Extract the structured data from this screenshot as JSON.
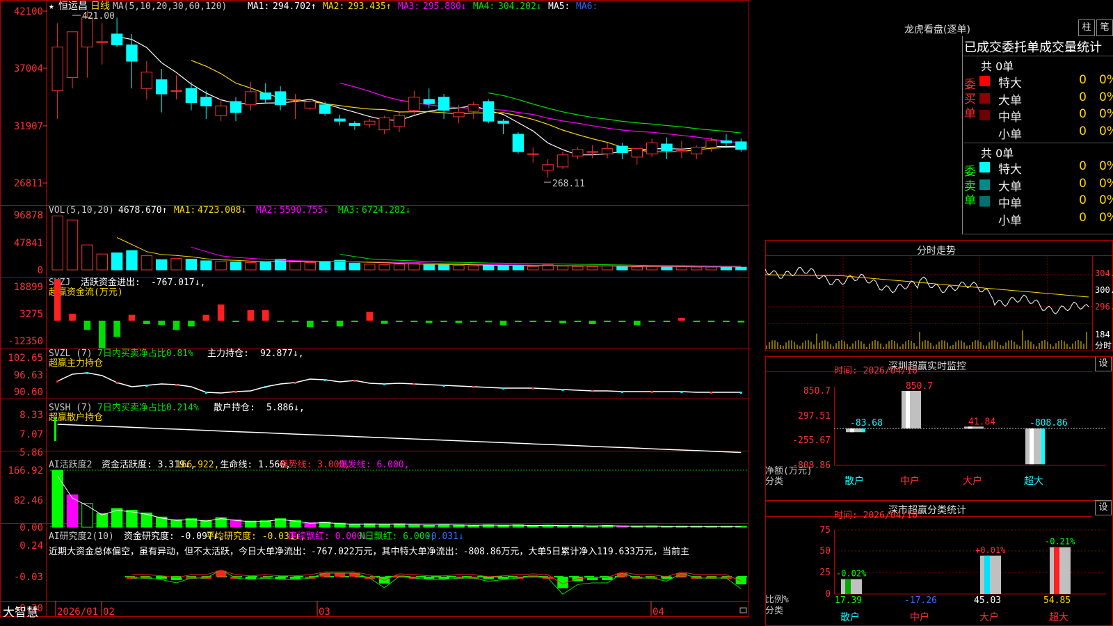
{
  "stock": {
    "star": "★",
    "name": "恒运昌",
    "period": "日线",
    "ma_title": "MA(5,10,20,30,60,120)",
    "ma": [
      {
        "k": "MA1:",
        "v": "294.702↑",
        "c": "#ffffff"
      },
      {
        "k": "MA2:",
        "v": "293.435↑",
        "c": "#ffd700"
      },
      {
        "k": "MA3:",
        "v": "295.880↓",
        "c": "#ff00ff"
      },
      {
        "k": "MA4:",
        "v": "304.202↓",
        "c": "#00e000"
      },
      {
        "k": "MA5:",
        "v": "",
        "c": "#ffffff"
      },
      {
        "k": "MA6:",
        "v": "",
        "c": "#3060ff"
      }
    ],
    "high_label": "421.00",
    "low_label": "268.11"
  },
  "axes": {
    "price": [
      "42100",
      "37004",
      "31907",
      "26811"
    ],
    "vol": [
      "96878",
      "47841",
      "0"
    ],
    "svzj": [
      "18899",
      "3275",
      "-12350"
    ],
    "svzl": [
      "102.65",
      "96.63",
      "90.60"
    ],
    "svsh": [
      "8.33",
      "7.07",
      "5.86"
    ],
    "ai": [
      "166.92",
      "82.46",
      "0.00"
    ],
    "ai2": [
      "0.24",
      "-0.03",
      "-0.30"
    ],
    "dates": [
      "2026/01",
      "02",
      "03",
      "04"
    ]
  },
  "panels": {
    "vol": {
      "title": "VOL(5,10,20)",
      "value": "4678.670↑",
      "ma": [
        {
          "k": "MA1:",
          "v": "4723.008↓",
          "c": "#ffd700"
        },
        {
          "k": "MA2:",
          "v": "5590.755↓",
          "c": "#ff00ff"
        },
        {
          "k": "MA3:",
          "v": "6724.282↓",
          "c": "#00e000"
        }
      ]
    },
    "svzj": {
      "title": "SVZJ",
      "desc": "活跃资金进出:",
      "value": "-767.017↓,",
      "sub": "超赢资金流(万元)"
    },
    "svzl": {
      "title": "SVZL (7)",
      "desc": "7日内买卖净占比0.81%",
      "desc2": "主力持仓:",
      "value": "92.877↓,",
      "sub": "超赢主力持仓"
    },
    "svsh": {
      "title": "SVSH (7)",
      "desc": "7日内买卖净占比0.214%",
      "desc2": "散户持仓:",
      "value": "5.886↓,",
      "sub": "超赢散户持仓"
    },
    "ai": {
      "title": "AI活跃度2",
      "items": [
        {
          "t": "资金活跃度: 3.319↓,",
          "c": "#ffffff"
        },
        {
          "t": "166.922,",
          "c": "#ffd700"
        },
        {
          "t": "生命线: 1.560,",
          "c": "#ffffff"
        },
        {
          "t": "强势线: 3.000,",
          "c": "#ff3030"
        },
        {
          "t": "爆发线: 6.000,",
          "c": "#ff00ff"
        }
      ]
    },
    "ai2": {
      "title": "AI研究度2(10)",
      "items": [
        {
          "t": "资金研究度: -0.097↓,",
          "c": "#ffffff"
        },
        {
          "t": "平均研究度: -0.031↓,",
          "c": "#ffd700"
        },
        {
          "t": "连续飘红: 0.000↓,",
          "c": "#ff00ff"
        },
        {
          "t": "N日飘红: 6.000,",
          "c": "#00e000"
        },
        {
          "t": "-0.031↓",
          "c": "#3070ff"
        }
      ],
      "commentary": "近期大资金总体偏空，虽有异动，但不太活跃，今日大单净流出：-767.022万元，其中特大单净流出：-808.86万元，大单5日累计净入119.633万元，当前主"
    }
  },
  "brand": "大智慧",
  "longhu": {
    "title": "龙虎看盘(逐单)",
    "btn_zhu": "柱",
    "btn_bi": "笔",
    "table_title": "已成交委托单成交量统计",
    "buy": {
      "label": "委买单",
      "total": "共 0单",
      "rows": [
        {
          "name": "特大",
          "n": "0",
          "p": "0%",
          "c": "#ff0000"
        },
        {
          "name": "大单",
          "n": "0",
          "p": "0%",
          "c": "#8b0000"
        },
        {
          "name": "中单",
          "n": "0",
          "p": "0%",
          "c": "#6b0000"
        },
        {
          "name": "小单",
          "n": "0",
          "p": "0%",
          "c": "#000000"
        }
      ]
    },
    "sell": {
      "label": "委卖单",
      "total": "共 0单",
      "rows": [
        {
          "name": "特大",
          "n": "0",
          "p": "0%",
          "c": "#00ffff"
        },
        {
          "name": "大单",
          "n": "0",
          "p": "0%",
          "c": "#008b8b"
        },
        {
          "name": "中单",
          "n": "0",
          "p": "0%",
          "c": "#007070"
        },
        {
          "name": "小单",
          "n": "0",
          "p": "0%",
          "c": "#000000"
        }
      ]
    }
  },
  "intraday": {
    "title": "分时走势",
    "price_labels": [
      "304.",
      "300.",
      "296.8"
    ],
    "vol_label": "184",
    "sub": "分时"
  },
  "monitor": {
    "title": "深圳超赢实时监控",
    "set": "设",
    "date": "时间: 2026/04/10",
    "yticks": [
      "850.7",
      "297.51",
      "-255.67",
      "-808.86"
    ],
    "ylabel": "净额(万元)",
    "xlabel": "分类"
  },
  "classify": {
    "title": "深市超赢分类统计",
    "set": "设",
    "date": "时间: 2026/04/10",
    "yticks": [
      "75",
      "50",
      "25",
      "0"
    ],
    "ylabel": "比例%",
    "xlabel": "分类"
  },
  "chart_data": [
    {
      "type": "candlestick",
      "title": "恒运昌 日线",
      "y_axis_ticks": [
        42100,
        37004,
        31907,
        26811
      ],
      "high": 421.0,
      "low": 268.11,
      "ohlc": [
        [
          348,
          410,
          322,
          388
        ],
        [
          360,
          398,
          350,
          402
        ],
        [
          388,
          421,
          360,
          415
        ],
        [
          392,
          410,
          372,
          393
        ],
        [
          400,
          415,
          388,
          390
        ],
        [
          390,
          400,
          350,
          375
        ],
        [
          350,
          375,
          340,
          365
        ],
        [
          358,
          368,
          328,
          345
        ],
        [
          348,
          362,
          340,
          348
        ],
        [
          350,
          356,
          330,
          337
        ],
        [
          342,
          348,
          322,
          334
        ],
        [
          325,
          340,
          320,
          334
        ],
        [
          338,
          342,
          320,
          328
        ],
        [
          335,
          356,
          330,
          347
        ],
        [
          346,
          355,
          336,
          340
        ],
        [
          347,
          352,
          330,
          335
        ],
        [
          340,
          345,
          322,
          340
        ],
        [
          332,
          340,
          330,
          338
        ],
        [
          335,
          338,
          325,
          327
        ],
        [
          322,
          326,
          316,
          320
        ],
        [
          318,
          320,
          312,
          316
        ],
        [
          317,
          322,
          314,
          320
        ],
        [
          312,
          325,
          308,
          323
        ],
        [
          315,
          328,
          310,
          325
        ],
        [
          330,
          348,
          326,
          342
        ],
        [
          340,
          350,
          332,
          336
        ],
        [
          342,
          345,
          322,
          330
        ],
        [
          324,
          335,
          318,
          328
        ],
        [
          329,
          338,
          322,
          335
        ],
        [
          338,
          340,
          318,
          320
        ],
        [
          320,
          322,
          308,
          318
        ],
        [
          308,
          310,
          290,
          292
        ],
        [
          290,
          296,
          282,
          290
        ],
        [
          275,
          285,
          268.11,
          280
        ],
        [
          278,
          292,
          276,
          289
        ],
        [
          288,
          296,
          285,
          294
        ],
        [
          292,
          298,
          286,
          292
        ],
        [
          290,
          300,
          286,
          295
        ],
        [
          297,
          300,
          285,
          291
        ],
        [
          287,
          292,
          280,
          295
        ],
        [
          290,
          304,
          287,
          300
        ],
        [
          299,
          305,
          285,
          293
        ],
        [
          292,
          302,
          286,
          293
        ],
        [
          290,
          298,
          285,
          296
        ],
        [
          296,
          305,
          292,
          302
        ],
        [
          302,
          308,
          296,
          300
        ],
        [
          301,
          304,
          292,
          294
        ]
      ],
      "ma_values": {
        "MA1": 294.702,
        "MA2": 293.435,
        "MA3": 295.88,
        "MA4": 304.202
      }
    },
    {
      "type": "bar",
      "title": "VOL(5,10,20)",
      "y_axis_ticks": [
        96878,
        47841,
        0
      ],
      "values": [
        95000,
        88000,
        44000,
        28000,
        30000,
        34000,
        25000,
        18000,
        20000,
        19000,
        16000,
        15000,
        14000,
        13000,
        14000,
        19000,
        14000,
        13000,
        15000,
        17000,
        12000,
        10000,
        9000,
        10000,
        11000,
        9000,
        9000,
        8000,
        7000,
        9000,
        7000,
        8000,
        6000,
        9000,
        7000,
        6000,
        6000,
        7000,
        6000,
        5000,
        6000,
        5000,
        6000,
        5000,
        5000,
        5000,
        4678.67
      ]
    },
    {
      "type": "bar",
      "title": "超赢资金流(万元)",
      "y_axis_ticks": [
        18899,
        3275,
        -12350
      ],
      "values": [
        18000,
        3000,
        -4000,
        -12000,
        -7000,
        2500,
        -1500,
        -1800,
        -4000,
        -2500,
        2500,
        7000,
        -400,
        4500,
        4500,
        -200,
        -300,
        -2800,
        -300,
        -2500,
        -300,
        3800,
        -1400,
        -400,
        -500,
        -1000,
        -300,
        -1000,
        -200,
        -700,
        -2000,
        -400,
        -100,
        -300,
        -1200,
        -200,
        -1500,
        -200,
        -300,
        -2000,
        -100,
        -200,
        1200,
        -300,
        -100,
        -200,
        -767.017
      ]
    },
    {
      "type": "line",
      "title": "超赢主力持仓",
      "y_axis_ticks": [
        102.65,
        96.63,
        90.6
      ],
      "final": 92.877
    },
    {
      "type": "line",
      "title": "超赢散户持仓",
      "y_axis_ticks": [
        8.33,
        7.07,
        5.86
      ],
      "final": 5.886
    },
    {
      "type": "bar",
      "title": "AI活跃度2",
      "y_axis_ticks": [
        166.92,
        82.46,
        0.0
      ],
      "values": [
        166.92,
        95,
        70,
        40,
        55,
        50,
        42,
        30,
        22,
        25,
        20,
        28,
        22,
        18,
        19,
        25,
        20,
        13,
        15,
        12,
        9,
        10,
        9,
        10,
        8,
        7,
        8,
        7,
        6,
        7,
        6,
        7,
        5,
        6,
        5,
        5,
        4,
        5,
        4,
        3.6,
        3.8,
        3.3,
        3.5,
        3.4,
        3.3,
        3.4,
        3.319
      ]
    },
    {
      "type": "bar",
      "title": "AI研究度2(10)",
      "y_axis_ticks": [
        0.24,
        -0.03,
        -0.3
      ],
      "values": [
        -0.03,
        -0.03,
        -0.03,
        -0.035,
        -0.04,
        -0.03,
        -0.03,
        -0.04,
        -0.06,
        -0.03,
        -0.03,
        0.02,
        -0.03,
        -0.04,
        -0.03,
        -0.04,
        -0.04,
        -0.03,
        0.0,
        0.0,
        0.0,
        -0.03,
        -0.09,
        -0.02,
        -0.03,
        -0.04,
        -0.04,
        -0.03,
        -0.03,
        -0.05,
        -0.04,
        -0.03,
        -0.02,
        -0.03,
        -0.13,
        -0.07,
        -0.06,
        -0.06,
        0.0,
        -0.03,
        -0.03,
        -0.05,
        0.0,
        -0.03,
        -0.03,
        -0.03,
        -0.097
      ]
    },
    {
      "type": "bar",
      "title": "深圳超赢实时监控",
      "categories": [
        "散户",
        "中户",
        "大户",
        "超大"
      ],
      "values": [
        -83.68,
        850.7,
        41.84,
        -808.86
      ],
      "y_axis_ticks": [
        850.7,
        297.51,
        -255.67,
        -808.86
      ]
    },
    {
      "type": "bar",
      "title": "深市超赢分类统计",
      "categories": [
        "散户",
        "中户",
        "大户",
        "超大"
      ],
      "series": [
        {
          "values": [
            17.39,
            -17.26,
            45.03,
            54.85
          ]
        },
        {
          "values": [
            -0.02,
            null,
            0.01,
            -0.21
          ]
        }
      ],
      "y_axis_ticks": [
        75,
        50,
        25,
        0
      ]
    }
  ]
}
